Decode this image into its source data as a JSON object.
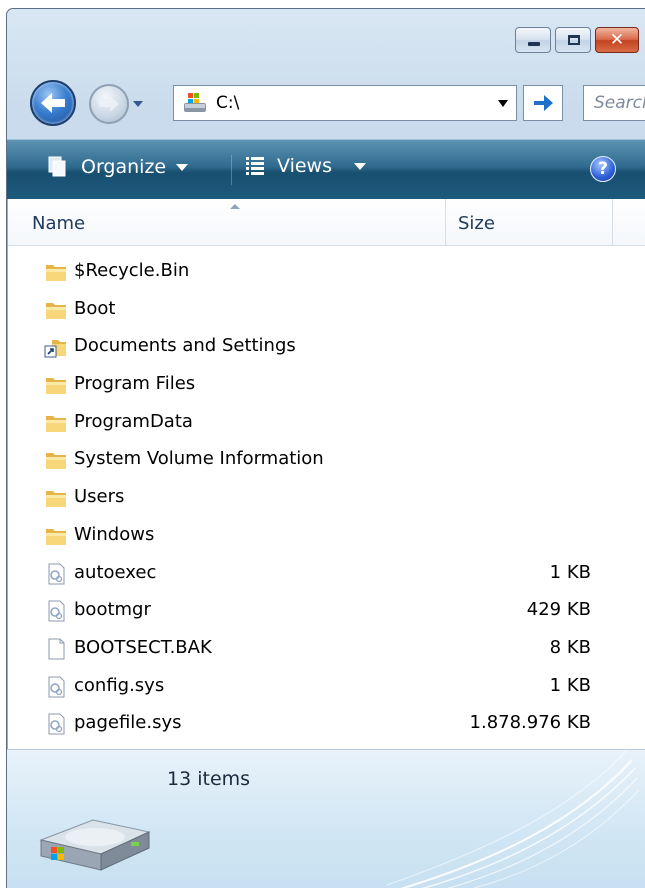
{
  "window": {
    "address": "C:\\",
    "search_placeholder": "Search"
  },
  "toolbar": {
    "organize_label": "Organize",
    "views_label": "Views",
    "help_label": "?"
  },
  "columns": {
    "name": "Name",
    "size": "Size"
  },
  "files": [
    {
      "name": "$Recycle.Bin",
      "size": "",
      "icon": "folder-icon"
    },
    {
      "name": "Boot",
      "size": "",
      "icon": "folder-icon"
    },
    {
      "name": "Documents and Settings",
      "size": "",
      "icon": "folder-shortcut-icon"
    },
    {
      "name": "Program Files",
      "size": "",
      "icon": "folder-icon"
    },
    {
      "name": "ProgramData",
      "size": "",
      "icon": "folder-icon"
    },
    {
      "name": "System Volume Information",
      "size": "",
      "icon": "folder-icon"
    },
    {
      "name": "Users",
      "size": "",
      "icon": "folder-icon"
    },
    {
      "name": "Windows",
      "size": "",
      "icon": "folder-icon"
    },
    {
      "name": "autoexec",
      "size": "1 KB",
      "icon": "system-file-icon"
    },
    {
      "name": "bootmgr",
      "size": "429 KB",
      "icon": "system-file-icon"
    },
    {
      "name": "BOOTSECT.BAK",
      "size": "8 KB",
      "icon": "blank-file-icon"
    },
    {
      "name": "config.sys",
      "size": "1 KB",
      "icon": "system-file-icon"
    },
    {
      "name": "pagefile.sys",
      "size": "1.878.976 KB",
      "icon": "system-file-icon"
    }
  ],
  "status": {
    "item_count": "13 items"
  }
}
